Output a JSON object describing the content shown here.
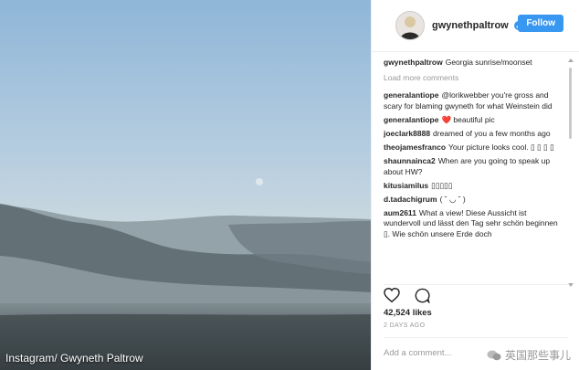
{
  "photo": {
    "credit": "Instagram/ Gwyneth Paltrow"
  },
  "post": {
    "username": "gwynethpaltrow",
    "follow_label": "Follow",
    "caption_user": "gwynethpaltrow",
    "caption_text": "Georgia sunrise/moonset",
    "load_more": "Load more comments"
  },
  "comments": [
    {
      "user": "generalantiope",
      "text": "@lorikwebber you're gross and scary for blaming gwyneth for what Weinstein did"
    },
    {
      "user": "generalantiope",
      "text": "❤️ beautiful pic"
    },
    {
      "user": "joeclark8888",
      "text": "dreamed of you a few months ago"
    },
    {
      "user": "theojamesfranco",
      "text": "Your picture looks cool. ▯ ▯ ▯ ▯"
    },
    {
      "user": "shaunnainca2",
      "text": "When are you going to speak up about HW?"
    },
    {
      "user": "kitusiamilus",
      "text": "▯▯▯▯▯"
    },
    {
      "user": "d.tadachigrum",
      "text": "( ˘ ◡ ˘ )"
    },
    {
      "user": "aum2611",
      "text": "What a view! Diese Aussicht ist wundervoll und lässt den Tag sehr schön beginnen ▯. Wie schön unsere Erde doch"
    }
  ],
  "stats": {
    "likes": "42,524 likes",
    "time": "2 DAYS AGO"
  },
  "composer": {
    "placeholder": "Add a comment..."
  },
  "watermark": {
    "text": "英国那些事儿"
  },
  "icons": {
    "like": "heart-icon",
    "comment": "comment-icon",
    "menu": "more-icon",
    "verified": "verified-icon"
  },
  "colors": {
    "accent": "#3897f0",
    "text": "#262626",
    "muted": "#999999"
  }
}
